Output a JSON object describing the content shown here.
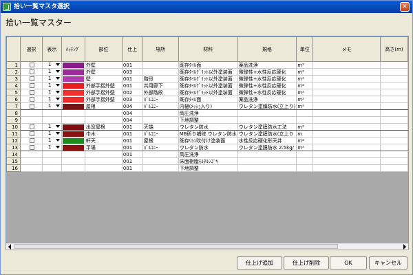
{
  "window": {
    "title": "拾い一覧マスタ選択",
    "close_glyph": "✕",
    "icon": "app-icon"
  },
  "heading": "拾い一覧マスター",
  "columns": [
    "",
    "選択",
    "表示",
    "ﾊｯﾁﾝｸﾞ",
    "部位",
    "仕上",
    "場所",
    "材料",
    "規格",
    "単位",
    "メモ",
    "高さ(m)"
  ],
  "rows": [
    {
      "num": "1",
      "check": true,
      "disp": "1",
      "color": "#8a1a8a",
      "part": "外壁",
      "finish": "001",
      "place": "",
      "material": "既存ﾀｲﾙ面",
      "spec": "薬品洗浄",
      "unit": "m²"
    },
    {
      "num": "2",
      "check": true,
      "disp": "1",
      "color": "#9b2a9b",
      "part": "外壁",
      "finish": "003",
      "place": "",
      "material": "既存ﾀｲﾙｸﾞﾘｯﾄ以外塗装面",
      "spec": "微弾性+水性反応硬化",
      "unit": "m²"
    },
    {
      "num": "3",
      "check": true,
      "disp": "1",
      "color": "#b03cb0",
      "part": "壁",
      "finish": "001",
      "place": "階段",
      "material": "既存ﾀｲﾙｸﾞﾘｯﾄ以外塗装面",
      "spec": "微弾性+水性反応硬化",
      "unit": "m²"
    },
    {
      "num": "4",
      "check": true,
      "disp": "1",
      "color": "#e62020",
      "part": "外部手摺外壁",
      "finish": "001",
      "place": "共用廊下",
      "material": "既存ﾀｲﾙｸﾞﾘｯﾄ以外塗装面",
      "spec": "微弾性+水性反応硬化",
      "unit": "m²"
    },
    {
      "num": "5",
      "check": true,
      "disp": "1",
      "color": "#f03030",
      "part": "外部手摺外壁",
      "finish": "002",
      "place": "外部階段",
      "material": "既存ﾀｲﾙｸﾞﾘｯﾄ以外塗装面",
      "spec": "微弾性+水性反応硬化",
      "unit": "m²"
    },
    {
      "num": "6",
      "check": true,
      "disp": "1",
      "color": "#ee2a2a",
      "part": "外部手摺外壁",
      "finish": "003",
      "place": "ﾊﾞﾙｺﾆｰ",
      "material": "既存ﾀｲﾙ面",
      "spec": "薬品洗浄",
      "unit": "m²"
    },
    {
      "num": "7",
      "check": true,
      "disp": "1",
      "color": "#7a1414",
      "part": "屋根",
      "finish": "004",
      "place": "ﾊﾞﾙｺﾆｰ",
      "material": "内樋(ﾒｯｼｭ入り)",
      "spec": "ウレタン塗膜防水(立上り)",
      "unit": "m²"
    },
    {
      "num": "8",
      "check": false,
      "disp": "",
      "color": "",
      "part": "",
      "finish": "004",
      "place": "",
      "material": "高圧洗浄",
      "spec": "",
      "unit": ""
    },
    {
      "num": "9",
      "check": false,
      "disp": "",
      "color": "",
      "part": "",
      "finish": "004",
      "place": "",
      "material": "下地調整",
      "spec": "",
      "unit": ""
    },
    {
      "num": "10",
      "check": true,
      "disp": "1",
      "color": "#7a1010",
      "part": "出窓屋根",
      "finish": "001",
      "place": "天端",
      "material": "ウレタン防水",
      "spec": "ウレタン塗膜防水工法",
      "unit": "m²"
    },
    {
      "num": "11",
      "check": true,
      "disp": "1",
      "color": "#8b1212",
      "part": "巾木",
      "finish": "001",
      "place": "ﾊﾞﾙｺﾆｰ",
      "material": "MB斫り補修 ウレタン防水",
      "spec": "ウレタン塗膜防水(立上り",
      "unit": "m"
    },
    {
      "num": "12",
      "check": true,
      "disp": "1",
      "color": "#1e8a1e",
      "part": "軒天",
      "finish": "001",
      "place": "屋根",
      "material": "既存ﾘｼﾝ吹付け塗装面",
      "spec": "水性反応硬化形天井",
      "unit": "m²"
    },
    {
      "num": "13",
      "check": true,
      "disp": "1",
      "color": "#8a1010",
      "part": "平場",
      "finish": "001",
      "place": "ﾊﾞﾙｺﾆｰ",
      "material": "ウレタン防水",
      "spec": "ウレタン塗膜防水 2.5kg/",
      "unit": "m²"
    },
    {
      "num": "14",
      "check": false,
      "disp": "",
      "color": "",
      "part": "",
      "finish": "001",
      "place": "",
      "material": "高圧洗浄",
      "spec": "",
      "unit": ""
    },
    {
      "num": "15",
      "check": false,
      "disp": "",
      "color": "",
      "part": "",
      "finish": "001",
      "place": "",
      "material": "床面樹脂ﾓﾙﾀﾙｼｺﾞｷ",
      "spec": "",
      "unit": ""
    },
    {
      "num": "16",
      "check": false,
      "disp": "",
      "color": "",
      "part": "",
      "finish": "001",
      "place": "",
      "material": "下地調整",
      "spec": "",
      "unit": ""
    }
  ],
  "buttons": {
    "add": "仕上げ追加",
    "delete": "仕上げ削除",
    "ok": "OK",
    "cancel": "キャンセル"
  }
}
